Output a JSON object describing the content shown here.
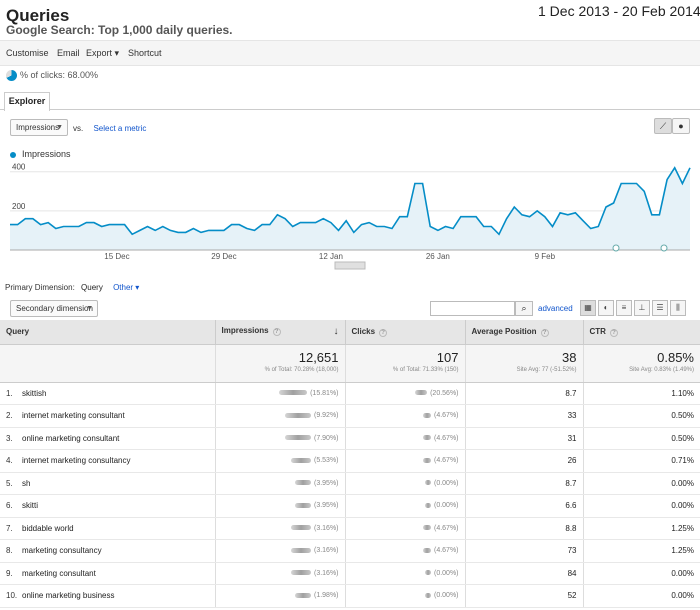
{
  "header": {
    "title": "Queries",
    "subtitle": "Google Search: Top 1,000 daily queries.",
    "date_range": "1 Dec 2013 - 20 Feb 2014"
  },
  "toolbar": {
    "customise": "Customise",
    "email": "Email",
    "export": "Export ▾",
    "shortcut": "Shortcut"
  },
  "segment": {
    "label": "% of clicks: 68.00%",
    "share": 0.68
  },
  "tabs": {
    "explorer": "Explorer"
  },
  "metric": {
    "selected": "Impressions",
    "vs": "vs.",
    "select_metric": "Select a metric"
  },
  "chart_data": {
    "type": "area",
    "series": [
      {
        "name": "Impressions",
        "color": "#058dc7",
        "values": [
          130,
          130,
          160,
          160,
          130,
          140,
          110,
          120,
          120,
          120,
          140,
          140,
          120,
          130,
          130,
          130,
          80,
          100,
          120,
          100,
          120,
          100,
          90,
          90,
          110,
          90,
          100,
          100,
          100,
          130,
          130,
          110,
          100,
          130,
          130,
          180,
          160,
          120,
          140,
          140,
          140,
          160,
          140,
          100,
          150,
          90,
          130,
          140,
          120,
          120,
          110,
          170,
          170,
          340,
          340,
          120,
          100,
          120,
          110,
          170,
          170,
          170,
          120,
          120,
          80,
          160,
          220,
          180,
          170,
          200,
          170,
          120,
          190,
          180,
          190,
          150,
          110,
          120,
          220,
          240,
          340,
          340,
          340,
          300,
          180,
          180,
          360,
          420,
          340,
          420
        ]
      }
    ],
    "x_tick_labels": [
      "15 Dec",
      "29 Dec",
      "12 Jan",
      "26 Jan",
      "9 Feb"
    ],
    "y_tick_labels": [
      "400",
      "200"
    ],
    "ylim": [
      0,
      460
    ]
  },
  "primary_dimension": {
    "label": "Primary Dimension:",
    "value": "Query",
    "other": "Other ▾"
  },
  "secondary_dimension": "Secondary dimension",
  "advanced": "advanced",
  "table": {
    "headers": [
      "Query",
      "Impressions",
      "Clicks",
      "Average Position",
      "CTR"
    ],
    "totals": {
      "impressions": "12,651",
      "impressions_sub": "% of Total: 70.28% (18,000)",
      "clicks": "107",
      "clicks_sub": "% of Total: 71.33% (150)",
      "position": "38",
      "position_sub": "Site Avg: 77 (-51.52%)",
      "ctr": "0.85%",
      "ctr_sub": "Site Avg: 0.83% (1.49%)"
    },
    "rows": [
      {
        "rank": "1.",
        "query": "skittish",
        "imp_pct": "(15.81%)",
        "clk_pct": "(20.56%)",
        "pos": "8.7",
        "ctr": "1.10%"
      },
      {
        "rank": "2.",
        "query": "internet marketing consultant",
        "imp_pct": "(9.92%)",
        "clk_pct": "(4.67%)",
        "pos": "33",
        "ctr": "0.50%"
      },
      {
        "rank": "3.",
        "query": "online marketing consultant",
        "imp_pct": "(7.90%)",
        "clk_pct": "(4.67%)",
        "pos": "31",
        "ctr": "0.50%"
      },
      {
        "rank": "4.",
        "query": "internet marketing consultancy",
        "imp_pct": "(5.53%)",
        "clk_pct": "(4.67%)",
        "pos": "26",
        "ctr": "0.71%"
      },
      {
        "rank": "5.",
        "query": "sh",
        "imp_pct": "(3.95%)",
        "clk_pct": "(0.00%)",
        "pos": "8.7",
        "ctr": "0.00%"
      },
      {
        "rank": "6.",
        "query": "skitti",
        "imp_pct": "(3.95%)",
        "clk_pct": "(0.00%)",
        "pos": "6.6",
        "ctr": "0.00%"
      },
      {
        "rank": "7.",
        "query": "biddable world",
        "imp_pct": "(3.16%)",
        "clk_pct": "(4.67%)",
        "pos": "8.8",
        "ctr": "1.25%"
      },
      {
        "rank": "8.",
        "query": "marketing consultancy",
        "imp_pct": "(3.16%)",
        "clk_pct": "(4.67%)",
        "pos": "73",
        "ctr": "1.25%"
      },
      {
        "rank": "9.",
        "query": "marketing consultant",
        "imp_pct": "(3.16%)",
        "clk_pct": "(0.00%)",
        "pos": "84",
        "ctr": "0.00%"
      },
      {
        "rank": "10.",
        "query": "online marketing business",
        "imp_pct": "(1.98%)",
        "clk_pct": "(0.00%)",
        "pos": "52",
        "ctr": "0.00%"
      }
    ]
  }
}
